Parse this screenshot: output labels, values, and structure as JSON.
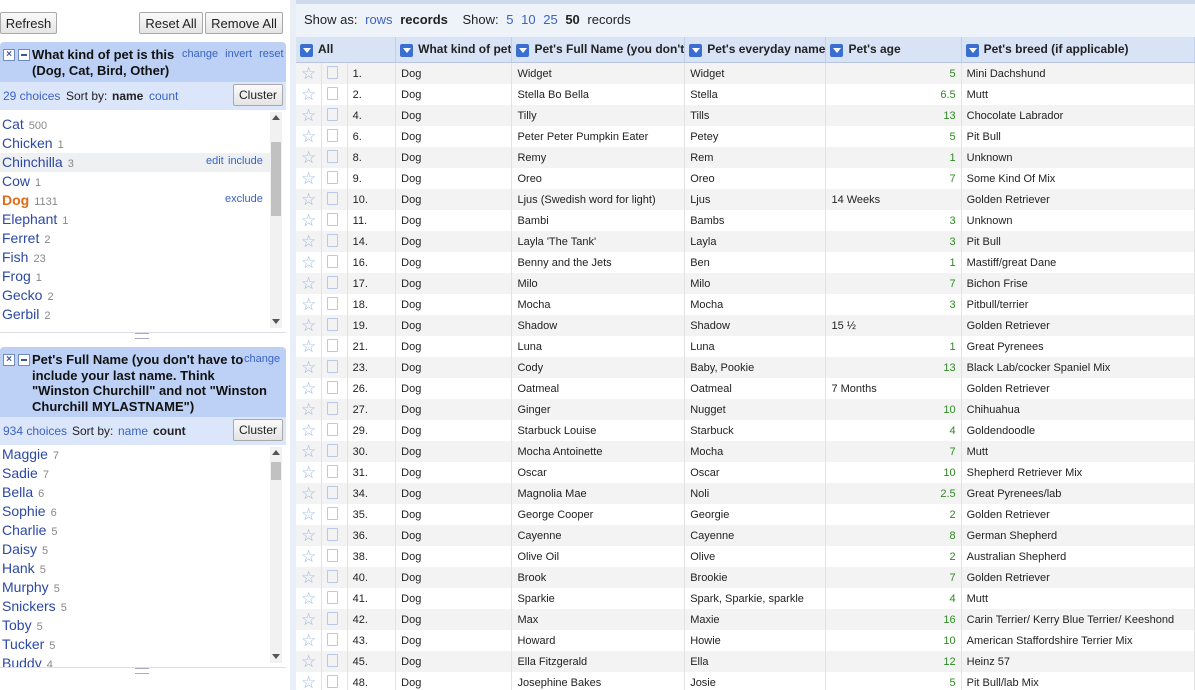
{
  "left": {
    "refresh_label": "Refresh",
    "reset_all_label": "Reset All",
    "remove_all_label": "Remove All",
    "facet1": {
      "title": "What kind of pet is this (Dog, Cat, Bird, Other)",
      "change": "change",
      "invert": "invert",
      "reset": "reset",
      "choices_count": "29 choices",
      "sort_by": "Sort by:",
      "sort_name": "name",
      "sort_count": "count",
      "cluster": "Cluster",
      "edit": "edit",
      "include": "include",
      "exclude": "exclude",
      "items": [
        {
          "label": "Cat",
          "count": "500"
        },
        {
          "label": "Chicken",
          "count": "1"
        },
        {
          "label": "Chinchilla",
          "count": "3"
        },
        {
          "label": "Cow",
          "count": "1"
        },
        {
          "label": "Dog",
          "count": "1131"
        },
        {
          "label": "Elephant",
          "count": "1"
        },
        {
          "label": "Ferret",
          "count": "2"
        },
        {
          "label": "Fish",
          "count": "23"
        },
        {
          "label": "Frog",
          "count": "1"
        },
        {
          "label": "Gecko",
          "count": "2"
        },
        {
          "label": "Gerbil",
          "count": "2"
        }
      ]
    },
    "facet2": {
      "title": "Pet's Full Name (you don't have to include your last name. Think \"Winston Churchill\" and not \"Winston Churchill MYLASTNAME\")",
      "change": "change",
      "choices_count": "934 choices",
      "sort_by": "Sort by:",
      "sort_name": "name",
      "sort_count": "count",
      "cluster": "Cluster",
      "items": [
        {
          "label": "Maggie",
          "count": "7"
        },
        {
          "label": "Sadie",
          "count": "7"
        },
        {
          "label": "Bella",
          "count": "6"
        },
        {
          "label": "Sophie",
          "count": "6"
        },
        {
          "label": "Charlie",
          "count": "5"
        },
        {
          "label": "Daisy",
          "count": "5"
        },
        {
          "label": "Hank",
          "count": "5"
        },
        {
          "label": "Murphy",
          "count": "5"
        },
        {
          "label": "Snickers",
          "count": "5"
        },
        {
          "label": "Toby",
          "count": "5"
        },
        {
          "label": "Tucker",
          "count": "5"
        },
        {
          "label": "Buddy",
          "count": "4"
        }
      ]
    }
  },
  "toolbar": {
    "show_as": "Show as:",
    "rows": "rows",
    "records": "records",
    "show": "Show:",
    "opt5": "5",
    "opt10": "10",
    "opt25": "25",
    "opt50": "50",
    "records_suffix": "records"
  },
  "table": {
    "columns": [
      "All",
      "What kind of pet",
      "Pet's Full Name (you don't",
      "Pet's everyday name",
      "Pet's age",
      "Pet's breed (if applicable)"
    ],
    "rows": [
      [
        "1.",
        "Dog",
        "Widget",
        "Widget",
        "5",
        "Mini Dachshund"
      ],
      [
        "2.",
        "Dog",
        "Stella Bo Bella",
        "Stella",
        "6.5",
        "Mutt"
      ],
      [
        "4.",
        "Dog",
        "Tilly",
        "Tills",
        "13",
        "Chocolate Labrador"
      ],
      [
        "6.",
        "Dog",
        "Peter Peter Pumpkin Eater",
        "Petey",
        "5",
        "Pit Bull"
      ],
      [
        "8.",
        "Dog",
        "Remy",
        "Rem",
        "1",
        "Unknown"
      ],
      [
        "9.",
        "Dog",
        "Oreo",
        "Oreo",
        "7",
        "Some Kind Of Mix"
      ],
      [
        "10.",
        "Dog",
        "Ljus  (Swedish word for light)",
        "Ljus",
        "14 Weeks",
        "Golden Retriever"
      ],
      [
        "11.",
        "Dog",
        "Bambi",
        "Bambs",
        "3",
        "Unknown"
      ],
      [
        "14.",
        "Dog",
        "Layla 'The Tank'",
        "Layla",
        "3",
        "Pit Bull"
      ],
      [
        "16.",
        "Dog",
        "Benny and the Jets",
        "Ben",
        "1",
        "Mastiff/great Dane"
      ],
      [
        "17.",
        "Dog",
        "Milo",
        "Milo",
        "7",
        "Bichon Frise"
      ],
      [
        "18.",
        "Dog",
        "Mocha",
        "Mocha",
        "3",
        "Pitbull/terrier"
      ],
      [
        "19.",
        "Dog",
        "Shadow",
        "Shadow",
        "15 ½",
        "Golden Retriever"
      ],
      [
        "21.",
        "Dog",
        "Luna",
        "Luna",
        "1",
        "Great Pyrenees"
      ],
      [
        "23.",
        "Dog",
        "Cody",
        "Baby, Pookie",
        "13",
        "Black Lab/cocker Spaniel Mix"
      ],
      [
        "26.",
        "Dog",
        "Oatmeal",
        "Oatmeal",
        "7 Months",
        "Golden Retriever"
      ],
      [
        "27.",
        "Dog",
        "Ginger",
        "Nugget",
        "10",
        "Chihuahua"
      ],
      [
        "29.",
        "Dog",
        "Starbuck Louise",
        "Starbuck",
        "4",
        "Goldendoodle"
      ],
      [
        "30.",
        "Dog",
        "Mocha Antoinette",
        "Mocha",
        "7",
        "Mutt"
      ],
      [
        "31.",
        "Dog",
        "Oscar",
        "Oscar",
        "10",
        "Shepherd Retriever Mix"
      ],
      [
        "34.",
        "Dog",
        "Magnolia Mae",
        "Noli",
        "2.5",
        "Great Pyrenees/lab"
      ],
      [
        "35.",
        "Dog",
        "George Cooper",
        "Georgie",
        "2",
        "Golden Retriever"
      ],
      [
        "36.",
        "Dog",
        "Cayenne",
        "Cayenne",
        "8",
        "German Shepherd"
      ],
      [
        "38.",
        "Dog",
        "Olive Oil",
        "Olive",
        "2",
        "Australian Shepherd"
      ],
      [
        "40.",
        "Dog",
        "Brook",
        "Brookie",
        "7",
        "Golden Retriever"
      ],
      [
        "41.",
        "Dog",
        "Sparkie",
        "Spark, Sparkie, sparkle",
        "4",
        "Mutt"
      ],
      [
        "42.",
        "Dog",
        "Max",
        "Maxie",
        "16",
        "Carin Terrier/ Kerry Blue Terrier/ Keeshond"
      ],
      [
        "43.",
        "Dog",
        "Howard",
        "Howie",
        "10",
        "American Staffordshire Terrier Mix"
      ],
      [
        "45.",
        "Dog",
        "Ella Fitzgerald",
        "Ella",
        "12",
        "Heinz 57"
      ],
      [
        "48.",
        "Dog",
        "Josephine Bakes",
        "Josie",
        "5",
        "Pit Bull/lab Mix"
      ]
    ]
  }
}
